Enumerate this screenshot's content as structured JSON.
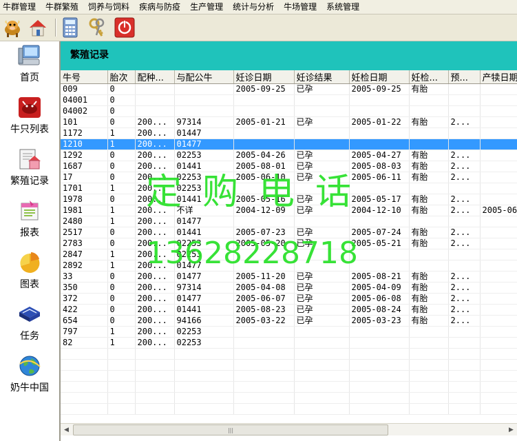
{
  "menu": [
    "牛群管理",
    "牛群繁殖",
    "饲养与饲料",
    "疾病与防疫",
    "生产管理",
    "统计与分析",
    "牛场管理",
    "系统管理"
  ],
  "toolbar": {
    "icons": [
      "cow-icon",
      "home-icon",
      "calculator-icon",
      "keys-icon",
      "power-icon"
    ]
  },
  "sidebar": {
    "items": [
      {
        "label": "首页",
        "icon": "computer-icon"
      },
      {
        "label": "牛只列表",
        "icon": "cow-list-icon"
      },
      {
        "label": "繁殖记录",
        "icon": "house-notes-icon"
      },
      {
        "label": "报表",
        "icon": "report-icon"
      },
      {
        "label": "图表",
        "icon": "chart-pie-icon"
      },
      {
        "label": "任务",
        "icon": "book-task-icon"
      },
      {
        "label": "奶牛中国",
        "icon": "globe-icon"
      }
    ]
  },
  "main": {
    "title": "繁殖记录"
  },
  "grid": {
    "columns": [
      "牛号",
      "胎次",
      "配种...",
      "与配公牛",
      "妊诊日期",
      "妊诊结果",
      "妊检日期",
      "妊检...",
      "预...",
      "产犊日期"
    ],
    "selected_row": 5,
    "rows": [
      [
        "009",
        "0",
        "",
        "",
        "2005-09-25",
        "已孕",
        "2005-09-25",
        "有胎",
        "",
        ""
      ],
      [
        "04001",
        "0",
        "",
        "",
        "",
        "",
        "",
        "",
        "",
        ""
      ],
      [
        "04002",
        "0",
        "",
        "",
        "",
        "",
        "",
        "",
        "",
        ""
      ],
      [
        "101",
        "0",
        "200...",
        "97314",
        "2005-01-21",
        "已孕",
        "2005-01-22",
        "有胎",
        "2...",
        ""
      ],
      [
        "1172",
        "1",
        "200...",
        "01447",
        "",
        "",
        "",
        "",
        "",
        ""
      ],
      [
        "1210",
        "1",
        "200...",
        "01477",
        "",
        "",
        "",
        "",
        "",
        ""
      ],
      [
        "1292",
        "0",
        "200...",
        "02253",
        "2005-04-26",
        "已孕",
        "2005-04-27",
        "有胎",
        "2...",
        ""
      ],
      [
        "1687",
        "0",
        "200...",
        "01441",
        "2005-08-01",
        "已孕",
        "2005-08-03",
        "有胎",
        "2...",
        ""
      ],
      [
        "17",
        "0",
        "200...",
        "02253",
        "2005-06-10",
        "已孕",
        "2005-06-11",
        "有胎",
        "2...",
        ""
      ],
      [
        "1701",
        "1",
        "200...",
        "02253",
        "",
        "",
        "",
        "",
        "",
        ""
      ],
      [
        "1978",
        "0",
        "200...",
        "01441",
        "2005-05-16",
        "已孕",
        "2005-05-17",
        "有胎",
        "2...",
        ""
      ],
      [
        "1981",
        "1",
        "200...",
        "不详",
        "2004-12-09",
        "已孕",
        "2004-12-10",
        "有胎",
        "2...",
        "2005-06"
      ],
      [
        "2480",
        "1",
        "200...",
        "01477",
        "",
        "",
        "",
        "",
        "",
        ""
      ],
      [
        "2517",
        "0",
        "200...",
        "01441",
        "2005-07-23",
        "已孕",
        "2005-07-24",
        "有胎",
        "2...",
        ""
      ],
      [
        "2783",
        "0",
        "200...",
        "02253",
        "2005-05-20",
        "已孕",
        "2005-05-21",
        "有胎",
        "2...",
        ""
      ],
      [
        "2847",
        "1",
        "200...",
        "02253",
        "",
        "",
        "",
        "",
        "",
        ""
      ],
      [
        "2892",
        "1",
        "200...",
        "01477",
        "",
        "",
        "",
        "",
        "",
        ""
      ],
      [
        "33",
        "0",
        "200...",
        "01477",
        "2005-11-20",
        "已孕",
        "2005-08-21",
        "有胎",
        "2...",
        ""
      ],
      [
        "350",
        "0",
        "200...",
        "97314",
        "2005-04-08",
        "已孕",
        "2005-04-09",
        "有胎",
        "2...",
        ""
      ],
      [
        "372",
        "0",
        "200...",
        "01477",
        "2005-06-07",
        "已孕",
        "2005-06-08",
        "有胎",
        "2...",
        ""
      ],
      [
        "422",
        "0",
        "200...",
        "01441",
        "2005-08-23",
        "已孕",
        "2005-08-24",
        "有胎",
        "2...",
        ""
      ],
      [
        "654",
        "0",
        "200...",
        "94166",
        "2005-03-22",
        "已孕",
        "2005-03-23",
        "有胎",
        "2...",
        ""
      ],
      [
        "797",
        "1",
        "200...",
        "02253",
        "",
        "",
        "",
        "",
        "",
        ""
      ],
      [
        "82",
        "1",
        "200...",
        "02253",
        "",
        "",
        "",
        "",
        "",
        ""
      ]
    ]
  },
  "watermark": {
    "line1": "定购电话",
    "line2": "13628228718"
  },
  "colors": {
    "header_bg": "#1fc3bb",
    "selection": "#3399ff",
    "watermark": "#27e027"
  }
}
